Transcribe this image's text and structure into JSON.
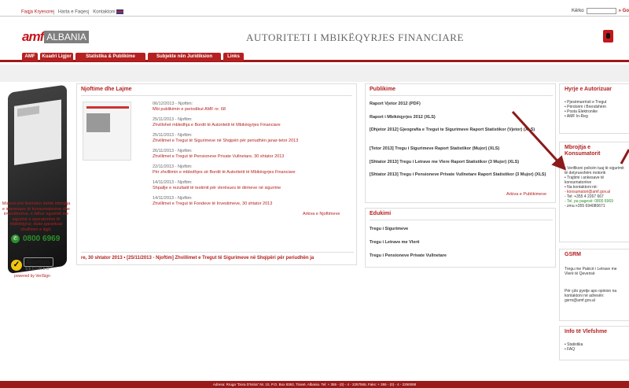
{
  "top": {
    "links": [
      "Faqja Kryesore",
      "Harta e Faqes",
      "Kontaktoni"
    ],
    "search_label": "Kërko",
    "go": "» Go"
  },
  "header": {
    "logo_amf": "amf",
    "logo_albania": "ALBANIA",
    "title": "AUTORITETI I MBIKËQYRJES FINANCIARE"
  },
  "nav": [
    "AMF",
    "Kuadri Ligjor",
    "Statistika & Publikime",
    "Subjekte nën Juridiksion",
    "Links"
  ],
  "left": {
    "message": "Misioni ynë themelor është mbrojtja e interesave të konsumatorëve dhe investitorëve, e lidhur ngushtë me sigurinë e operatorëve të mbikëqyrur, duke garantuar zhvillimin e ligjit.",
    "phone": "0800 6969",
    "norton": "Norton",
    "secured": "SECURED",
    "powered": "powered by VeriSign",
    "check": "✓",
    "phone_icon": "✆"
  },
  "news": {
    "title": "Njoftime dhe Lajme",
    "items": [
      {
        "date": "06/12/2013 - Njoftim:",
        "text": "Mbi publikimin e periodikut AMF nr. 68"
      },
      {
        "date": "25/11/2013 - Njoftim:",
        "text": "Zhvillohet mbledhja e Bordit të Autoritetit të Mbikëqyrjes Financiare"
      },
      {
        "date": "25/11/2013 - Njoftim:",
        "text": "Zhvillimet e Tregut të Sigurimeve në Shqipëri për periudhën janar-tetor 2013"
      },
      {
        "date": "26/11/2013 - Njoftim:",
        "text": "Zhvillimet e Tregut të Pensioneve Private Vullnetare, 30 shtator 2013"
      },
      {
        "date": "22/11/2013 - Njoftim:",
        "text": "Për zhvillimin e mbledhjes së Bordit të Autoritetit të Mbikëqyrjes Financiare"
      },
      {
        "date": "14/11/2013 - Njoftim:",
        "text": "Shpallje e rezultatit të testimit për vlerësues të dëmeve në sigurime"
      },
      {
        "date": "14/11/2013 - Njoftim:",
        "text": "Zhvillimet e Tregut të Fondeve të Investimeve, 30 shtator 2013"
      }
    ],
    "more": "Arkiva e Njoftimeve",
    "ticker": "re, 30 shtator 2013 •  [25/11/2013 - Njoftim] Zhvillimet e Tregut të Sigurimeve në Shqipëri për periudhën ja"
  },
  "pub": {
    "title": "Publikime",
    "items": [
      "Raport Vjetor 2012 (PDF)",
      "Raport i Mbikëqyrjes 2012 (XLS)",
      "[Dhjetor 2012] Gjeografia e Tregut te Sigurimeve Raport Statistikor  (Vjetor) (XLS)",
      "[Tetor 2013] Tregu i Sigurimeve Raport Statistikor (Mujor) (XLS)",
      "[Shtator 2013] Tregu i Letrave me Vlere Raport Statistikor  (3 Mujor) (XLS)",
      "[Shtator 2013] Tregu i Pensioneve Private Vullnetare Raport Statistikor  (3 Mujor) (XLS)"
    ],
    "more": "Arkiva e Publikimeve"
  },
  "edu": {
    "title": "Edukimi",
    "items": [
      "Tregu i Sigurimeve",
      "Tregu i Letrave me Vlerë",
      "Tregu i Pensioneve Private Vullnetare"
    ]
  },
  "side": {
    "hyrje": {
      "title": "Hyrje e Autorizuar",
      "items": [
        "• Pjesëmarrësit e Tregut",
        "• Përdorim i Brendshëm",
        "• Posta Elektronike",
        "• AMF In-Reg"
      ]
    },
    "mbrojtja": {
      "title": "Mbrojtja e Konsumatorit",
      "items": [
        "• Verifikoni policën tuaj të sigurimit të detyrueshëm motorik",
        "• Trajtimi i ankesave të konsumatorëve",
        "• Na kontaktoni në:",
        "  - konsumatori@amf.gov.al",
        "  - Tel: +355 4 2267 667",
        "  - Tel. pa pagesë: 0800 6969",
        "  - zmu:+355 694080671"
      ]
    },
    "gsrm": {
      "title": "GSRM",
      "p1": "Tregu me Pakicë i Letrave me Vlerë të Qeverisë",
      "p2": "Për çdo pyetje apo opinion na kontaktoni në adresën: gsrm@amf.gov.al"
    },
    "info": {
      "title": "Info të Vlefshme",
      "items": [
        "• Statistika",
        "• FAQ"
      ]
    }
  },
  "footer": "Adresa: Rruga \"Dora D'Istria\" Nr. 10, P.O. Box 8363, Tiranë, Albania. Tel: + 355 - (0) - 4 - 2257555, Faks: + 355 - (0) - 4 - 2250088"
}
